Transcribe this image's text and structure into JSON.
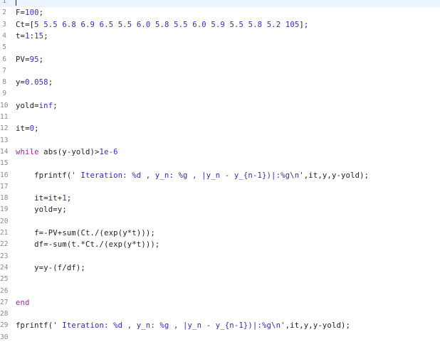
{
  "editor": {
    "lines": [
      {
        "n": "1",
        "code": ""
      },
      {
        "n": "2",
        "code": "F=100;"
      },
      {
        "n": "3",
        "code": "Ct=[5 5.5 6.8 6.9 6.5 5.5 6.0 5.8 5.5 6.0 5.9 5.5 5.8 5.2 105];"
      },
      {
        "n": "4",
        "code": "t=1:15;"
      },
      {
        "n": "5",
        "code": ""
      },
      {
        "n": "6",
        "code": "PV=95;"
      },
      {
        "n": "7",
        "code": ""
      },
      {
        "n": "8",
        "code": "y=0.058;"
      },
      {
        "n": "9",
        "code": ""
      },
      {
        "n": "10",
        "code": "yold=inf;"
      },
      {
        "n": "11",
        "code": ""
      },
      {
        "n": "12",
        "code": "it=0;"
      },
      {
        "n": "13",
        "code": ""
      },
      {
        "n": "14",
        "code": "while abs(y-yold)>1e-6"
      },
      {
        "n": "15",
        "code": ""
      },
      {
        "n": "16",
        "code": "    fprintf(' Iteration: %d , y_n: %g , |y_n - y_{n-1})|:%g\\n',it,y,y-yold);"
      },
      {
        "n": "17",
        "code": ""
      },
      {
        "n": "18",
        "code": "    it=it+1;"
      },
      {
        "n": "19",
        "code": "    yold=y;"
      },
      {
        "n": "20",
        "code": ""
      },
      {
        "n": "21",
        "code": "    f=-PV+sum(Ct./(exp(y*t)));"
      },
      {
        "n": "22",
        "code": "    df=-sum(t.*Ct./(exp(y*t)));"
      },
      {
        "n": "23",
        "code": ""
      },
      {
        "n": "24",
        "code": "    y=y-(f/df);"
      },
      {
        "n": "25",
        "code": ""
      },
      {
        "n": "26",
        "code": ""
      },
      {
        "n": "27",
        "code": "end"
      },
      {
        "n": "28",
        "code": ""
      },
      {
        "n": "29",
        "code": "fprintf(' Iteration: %d , y_n: %g , |y_n - y_{n-1})|:%g\\n',it,y,y-yold);"
      },
      {
        "n": "30",
        "code": ""
      }
    ]
  }
}
